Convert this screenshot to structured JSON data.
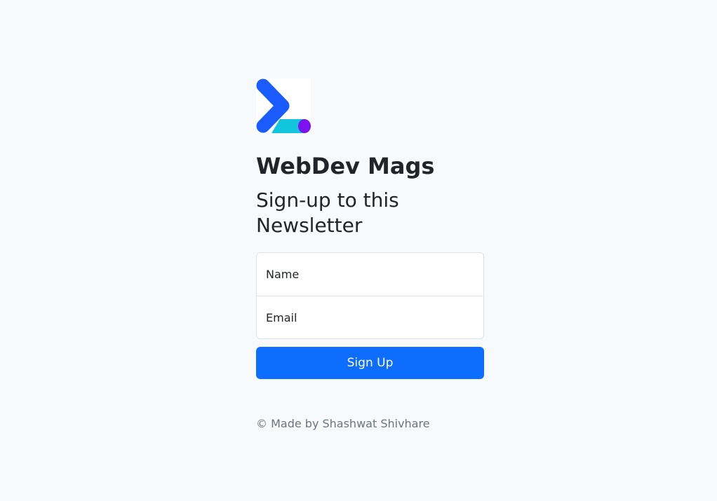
{
  "brand": {
    "logo_icon": "terminal-prompt-logo-icon",
    "title": "WebDev Mags"
  },
  "heading": "Sign-up to this Newsletter",
  "form": {
    "name_placeholder": "Name",
    "email_placeholder": "Email",
    "submit_label": "Sign Up"
  },
  "footer": {
    "text": "© Made by Shashwat Shivhare"
  },
  "colors": {
    "background": "#f8f9fa",
    "primary": "#0d6efd",
    "logo_blue": "#1a5cff",
    "logo_cyan": "#12c4dc",
    "logo_purple": "#7b12f0"
  }
}
